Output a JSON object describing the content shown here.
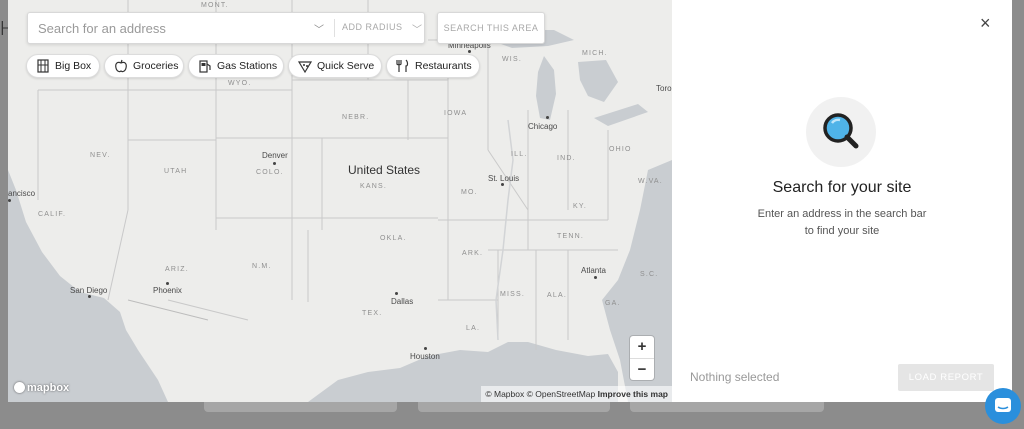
{
  "search": {
    "placeholder": "Search for an address",
    "radius_label": "ADD RADIUS",
    "search_area_label": "SEARCH THIS AREA"
  },
  "categories": [
    {
      "label": "Big Box",
      "icon": "building-icon"
    },
    {
      "label": "Groceries",
      "icon": "apple-icon"
    },
    {
      "label": "Gas Stations",
      "icon": "gas-pump-icon"
    },
    {
      "label": "Quick Serve",
      "icon": "pizza-icon"
    },
    {
      "label": "Restaurants",
      "icon": "fork-knife-icon"
    }
  ],
  "map": {
    "country_label": "United States",
    "state_labels": [
      "MONT.",
      "WYO.",
      "NEBR.",
      "IOWA",
      "NEV.",
      "UTAH",
      "COLO.",
      "KANS.",
      "MO.",
      "ILL.",
      "IND.",
      "OHIO",
      "W.VA.",
      "KY.",
      "CALIF.",
      "ARIZ.",
      "N.M.",
      "OKLA.",
      "ARK.",
      "TENN.",
      "S.C.",
      "MISS.",
      "ALA.",
      "GA.",
      "TEX.",
      "LA.",
      "MICH.",
      "WIS."
    ],
    "city_labels": [
      "Minneapolis",
      "Chicago",
      "Denver",
      "St. Louis",
      "Atlanta",
      "Phoenix",
      "San Diego",
      "Dallas",
      "Houston",
      "Toro",
      "ancisco"
    ],
    "zoom_in": "+",
    "zoom_out": "−",
    "logo_text": "mapbox",
    "attribution": "© Mapbox © OpenStreetMap",
    "improve_link": "Improve this map"
  },
  "panel": {
    "close_symbol": "×",
    "title": "Search for your site",
    "subtitle_line1": "Enter an address in the search bar",
    "subtitle_line2": "to find your site",
    "status": "Nothing selected",
    "load_button": "LOAD REPORT"
  },
  "colors": {
    "map_land": "#ededeb",
    "map_water": "#c9cdd1",
    "accent_blue": "#2a8fdc",
    "magnifier_lens": "#4fb3e8",
    "disabled_button": "#e5e5e5"
  }
}
